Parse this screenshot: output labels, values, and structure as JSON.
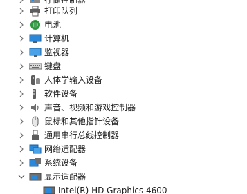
{
  "tree": {
    "items": [
      {
        "label": "存储控制器",
        "expanded": false,
        "icon": "storage-controller-icon"
      },
      {
        "label": "打印队列",
        "expanded": false,
        "icon": "printer-icon"
      },
      {
        "label": "电池",
        "expanded": false,
        "icon": "battery-icon"
      },
      {
        "label": "计算机",
        "expanded": false,
        "icon": "computer-icon"
      },
      {
        "label": "监视器",
        "expanded": false,
        "icon": "monitor-icon"
      },
      {
        "label": "键盘",
        "expanded": false,
        "icon": "keyboard-icon"
      },
      {
        "label": "人体学输入设备",
        "expanded": false,
        "icon": "hid-icon"
      },
      {
        "label": "软件设备",
        "expanded": false,
        "icon": "software-device-icon"
      },
      {
        "label": "声音、视频和游戏控制器",
        "expanded": false,
        "icon": "speaker-icon"
      },
      {
        "label": "鼠标和其他指针设备",
        "expanded": false,
        "icon": "mouse-icon"
      },
      {
        "label": "通用串行总线控制器",
        "expanded": false,
        "icon": "usb-icon"
      },
      {
        "label": "网络适配器",
        "expanded": false,
        "icon": "network-adapter-icon"
      },
      {
        "label": "系统设备",
        "expanded": false,
        "icon": "system-device-icon"
      },
      {
        "label": "显示适配器",
        "expanded": true,
        "icon": "display-adapter-icon"
      }
    ],
    "children": [
      {
        "label": "Intel(R) HD Graphics 4600",
        "icon": "graphics-card-icon"
      }
    ]
  },
  "colors": {
    "text": "#1e1e1e",
    "caret": "#707070",
    "icon_blue": "#2b88d8",
    "icon_gray": "#6d6d6d"
  }
}
